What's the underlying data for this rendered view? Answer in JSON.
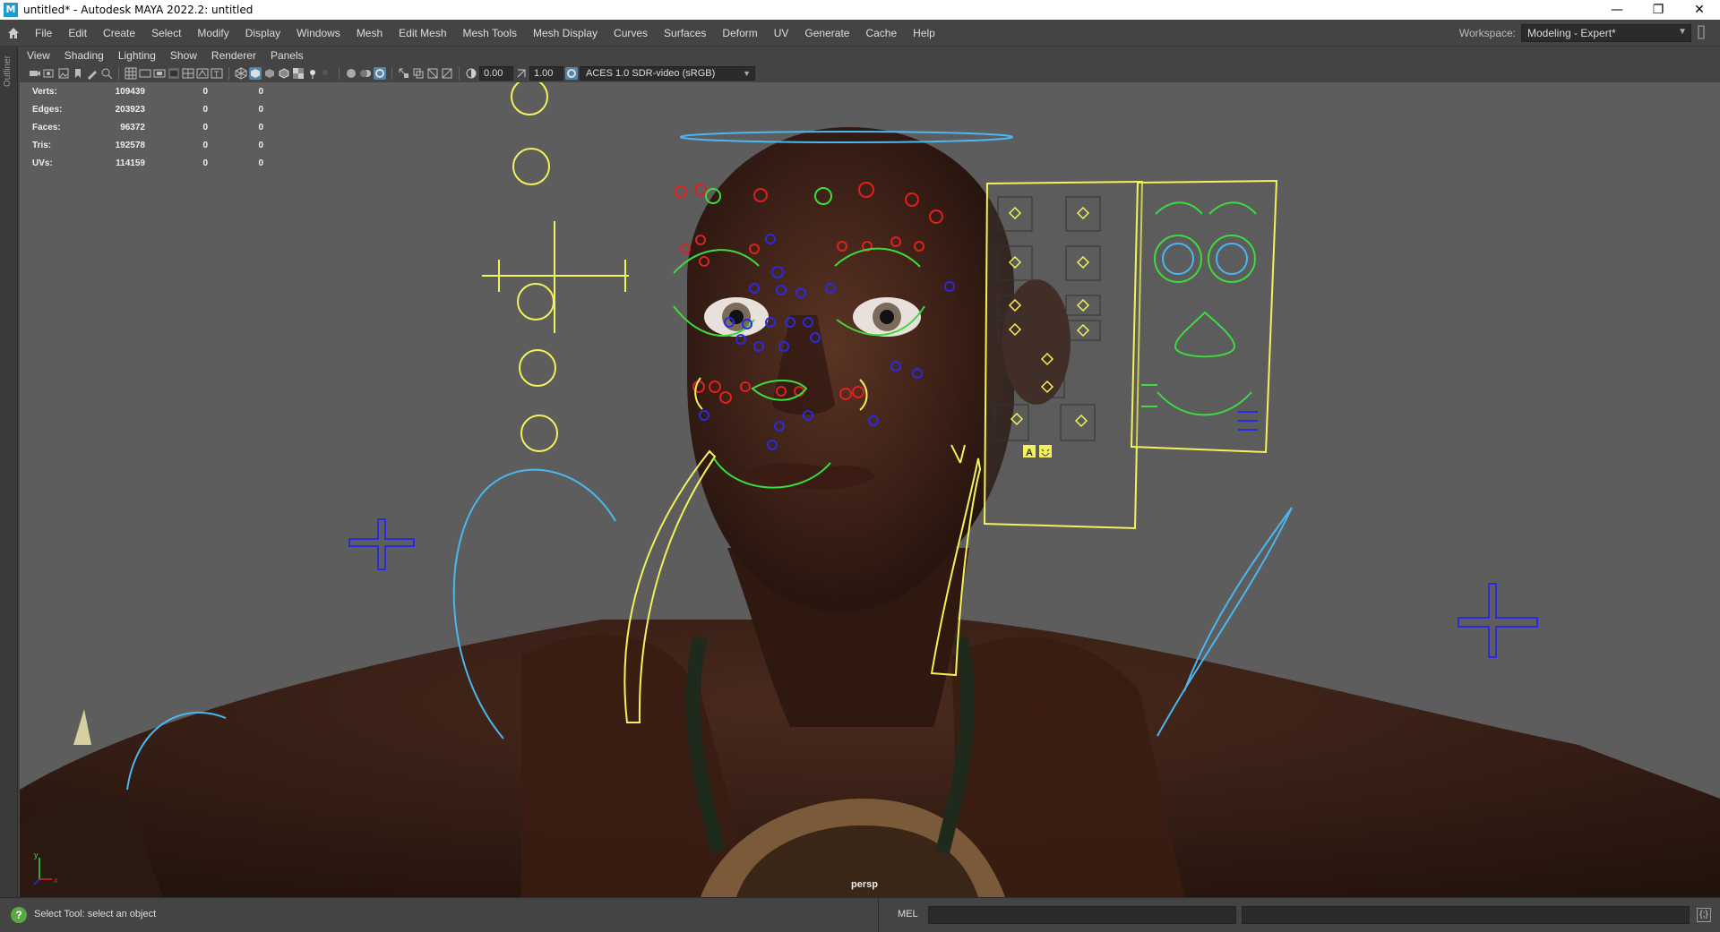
{
  "window": {
    "title": "untitled* - Autodesk MAYA 2022.2: untitled",
    "app_icon": "M",
    "minimize": "—",
    "restore": "❐",
    "close": "✕"
  },
  "menubar": {
    "items": [
      "File",
      "Edit",
      "Create",
      "Select",
      "Modify",
      "Display",
      "Windows",
      "Mesh",
      "Edit Mesh",
      "Mesh Tools",
      "Mesh Display",
      "Curves",
      "Surfaces",
      "Deform",
      "UV",
      "Generate",
      "Cache",
      "Help"
    ],
    "workspace_label": "Workspace:",
    "workspace_value": "Modeling - Expert*"
  },
  "outliner": {
    "label": "Outliner"
  },
  "panel_menu": {
    "items": [
      "View",
      "Shading",
      "Lighting",
      "Show",
      "Renderer",
      "Panels"
    ]
  },
  "viewport_toolbar": {
    "exposure": "0.00",
    "gamma": "1.00",
    "color_space": "ACES 1.0 SDR-video (sRGB)"
  },
  "hud": {
    "rows": [
      {
        "label": "Verts:",
        "v1": "109439",
        "v2": "0",
        "v3": "0"
      },
      {
        "label": "Edges:",
        "v1": "203923",
        "v2": "0",
        "v3": "0"
      },
      {
        "label": "Faces:",
        "v1": "96372",
        "v2": "0",
        "v3": "0"
      },
      {
        "label": "Tris:",
        "v1": "192578",
        "v2": "0",
        "v3": "0"
      },
      {
        "label": "UVs:",
        "v1": "114159",
        "v2": "0",
        "v3": "0"
      }
    ],
    "camera": "persp",
    "axis_x": "x",
    "axis_y": "y"
  },
  "panel_buttons": {
    "a": "A"
  },
  "helpline": {
    "help_text": "Select Tool: select an object",
    "mel_label": "MEL"
  },
  "colors": {
    "ui_bg": "#444444",
    "viewport_bg": "#5d5d5d",
    "ctrl_yellow": "#f2f25a",
    "ctrl_green": "#3ddb3d",
    "ctrl_red": "#e02020",
    "ctrl_blue": "#2a2ae0",
    "ctrl_cyan": "#4ab8f0"
  }
}
